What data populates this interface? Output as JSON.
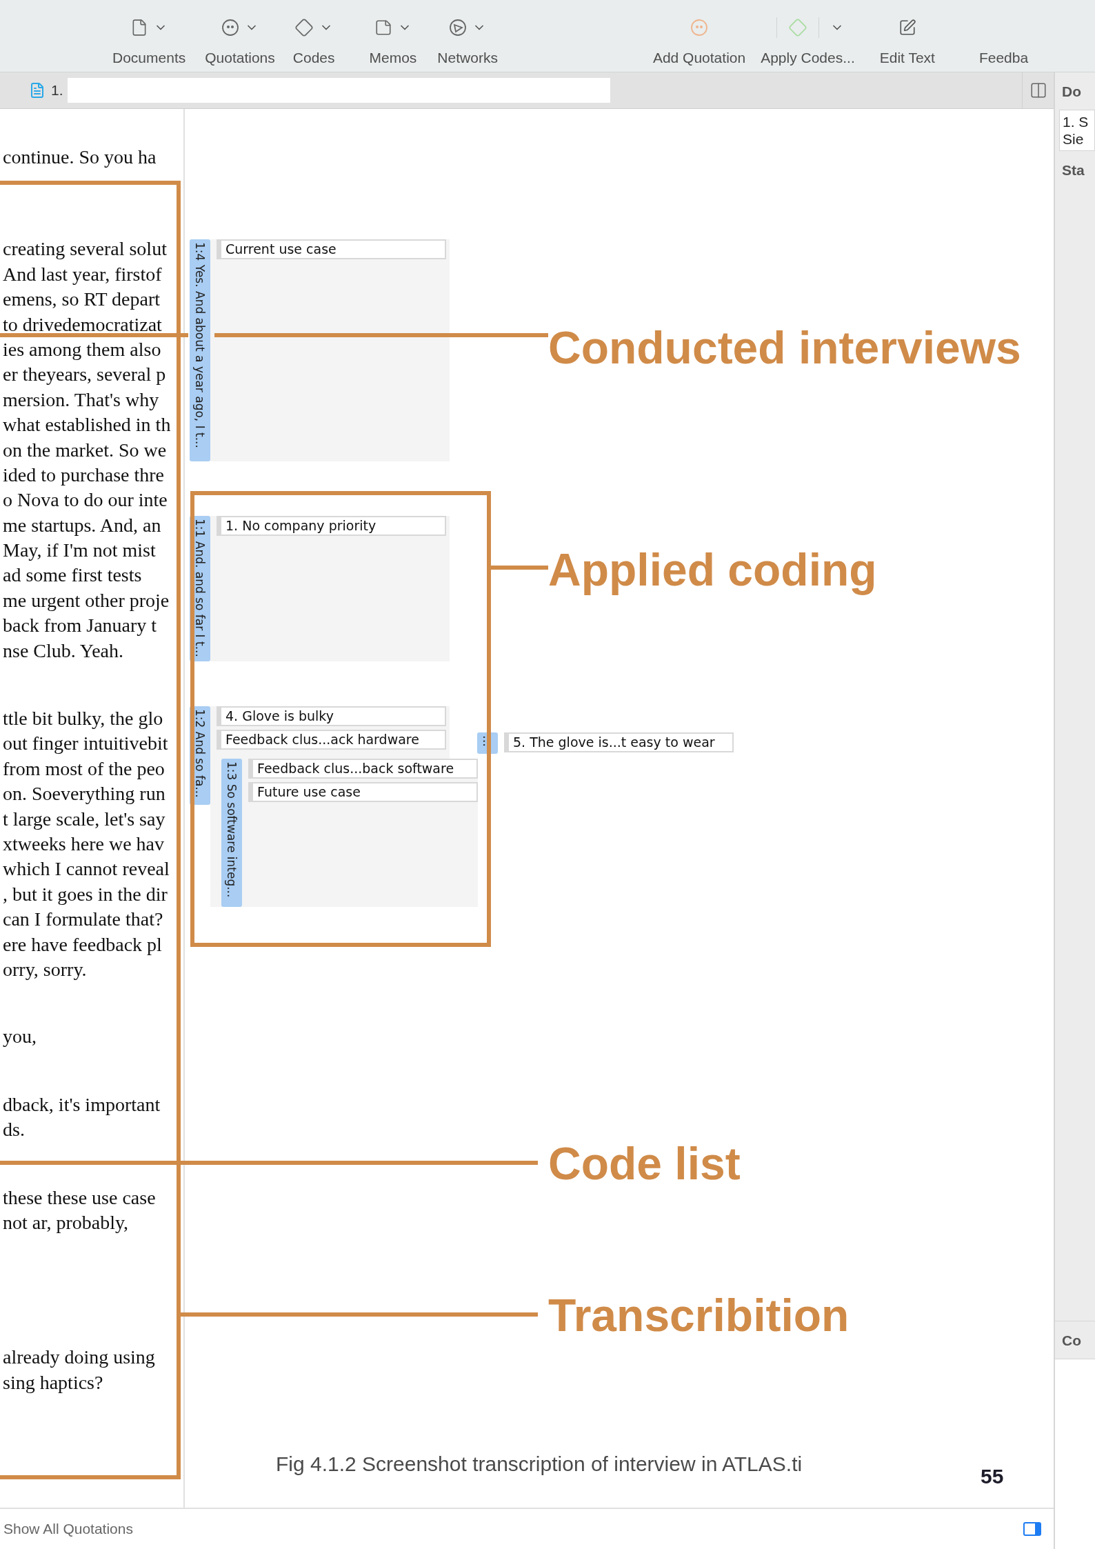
{
  "toolbar": {
    "items": [
      {
        "label": "Documents",
        "kind": "menu"
      },
      {
        "label": "Quotations",
        "kind": "menu"
      },
      {
        "label": "Codes",
        "kind": "menu"
      },
      {
        "label": "Memos",
        "kind": "menu"
      },
      {
        "label": "Networks",
        "kind": "menu"
      },
      {
        "label": "Add Quotation",
        "kind": "action"
      },
      {
        "label": "Apply Codes...",
        "kind": "split"
      },
      {
        "label": "Edit Text",
        "kind": "action"
      },
      {
        "label": "Feedba",
        "kind": "action"
      }
    ]
  },
  "document_tab": {
    "label": "1."
  },
  "transcript": {
    "paragraphs": [
      {
        "lines": [
          "continue. So you ha"
        ]
      },
      {
        "lines": [
          "creating several solut",
          "And last year, firstof",
          "emens, so RT depart",
          "to drivedemocratizat",
          "ies among them also",
          "er theyears, several p",
          "mersion. That's why",
          "what established in th",
          "on the market. So we",
          "ided to purchase thre",
          "o Nova to do our inte",
          "me startups. And, an",
          "May, if I'm not mist",
          "ad some first tests",
          "me urgent other proje",
          "back from January t",
          "nse Club. Yeah."
        ]
      },
      {
        "lines": [
          "ttle bit bulky, the glo",
          "out finger intuitivebit",
          "from most of the peo",
          "on. Soeverything run",
          "t large scale, let's say",
          "xtweeks here we hav",
          "which I cannot reveal",
          ", but it goes in the dir",
          "can I formulate that?",
          "ere have feedback pl",
          "orry, sorry."
        ]
      },
      {
        "lines": [
          "you,"
        ]
      },
      {
        "lines": [
          "dback, it's important",
          "ds."
        ]
      },
      {
        "lines": [
          "these these use case",
          "not ar, probably,"
        ]
      },
      {
        "lines": [
          "already doing using",
          "sing haptics?"
        ]
      }
    ]
  },
  "quotations": [
    {
      "label": "1:4 Yes. And about a year ago, I t...",
      "codes": [
        "Current use case"
      ]
    },
    {
      "label": "1:1 And. and so far I t...",
      "codes": [
        "1. No company priority"
      ]
    },
    {
      "label": "1:2 And so fa...",
      "codes": [
        "4. Glove is bulky",
        "Feedback clus...ack hardware"
      ],
      "children": [
        {
          "label": "1:3 So software integ...",
          "codes": [
            "Feedback clus...back software",
            "Future use case"
          ]
        }
      ]
    },
    {
      "label": "…",
      "codes": [
        "5. The glove is...t easy to wear"
      ]
    }
  ],
  "annotations": [
    {
      "label": "Conducted interviews"
    },
    {
      "label": "Applied coding"
    },
    {
      "label": "Code list"
    },
    {
      "label": "Transcribition"
    }
  ],
  "caption": "Fig 4.1.2 Screenshot transcription of interview in ATLAS.ti",
  "page_number": "55",
  "sidebar": {
    "header": "Do",
    "field_lines": [
      "1. S",
      "Sie"
    ],
    "section": "Sta",
    "lower_section": "Co"
  },
  "status_bar": {
    "label": "Show All Quotations"
  }
}
